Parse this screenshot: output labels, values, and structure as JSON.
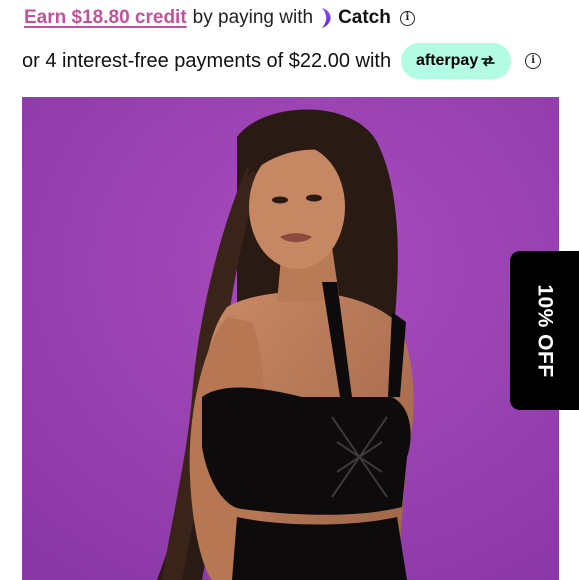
{
  "catch": {
    "credit_link": "Earn $18.80 credit",
    "text": "by paying with",
    "brand": "Catch",
    "brand_color": "#c4519c",
    "logo_icon": "catch-swoosh-icon",
    "info_icon": "info-icon"
  },
  "afterpay": {
    "text": "or 4 interest-free payments of $22.00 with",
    "badge_label": "afterpay",
    "badge_color": "#b2fce4",
    "badge_icon": "afterpay-arrows-icon",
    "info_icon": "info-icon"
  },
  "product_image": {
    "background_color": "#9a3fb0"
  },
  "discount_tab": {
    "label": "10% OFF"
  }
}
